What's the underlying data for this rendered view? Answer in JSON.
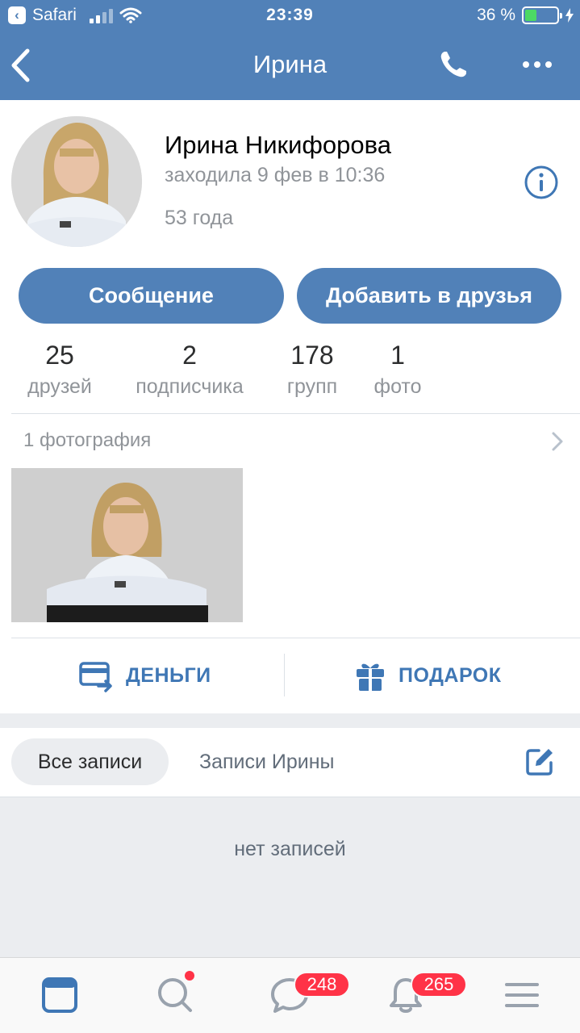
{
  "status_bar": {
    "back_app": "Safari",
    "time": "23:39",
    "battery": "36 %",
    "battery_level": 0.36
  },
  "nav": {
    "title": "Ирина",
    "icons": [
      "back-arrow-icon",
      "phone-icon",
      "more-icon"
    ]
  },
  "profile": {
    "name": "Ирина Никифорова",
    "last_seen": "заходила 9 фев в 10:36",
    "age": "53 года"
  },
  "buttons": {
    "message": "Сообщение",
    "add_friend": "Добавить в друзья"
  },
  "counters": [
    {
      "value": "25",
      "label": "друзей"
    },
    {
      "value": "2",
      "label": "подписчика"
    },
    {
      "value": "178",
      "label": "групп"
    },
    {
      "value": "1",
      "label": "фото"
    }
  ],
  "photos": {
    "header": "1 фотография"
  },
  "actions": {
    "money": "ДЕНЬГИ",
    "gift": "ПОДАРОК"
  },
  "posts": {
    "tab_all": "Все записи",
    "tab_own": "Записи Ирины",
    "empty": "нет записей"
  },
  "tabbar": {
    "icons": [
      "news-icon",
      "search-icon",
      "messages-icon",
      "notifications-icon",
      "menu-icon"
    ],
    "messages_badge": "248",
    "notifications_badge": "265"
  },
  "colors": {
    "header": "#5181b8",
    "accent": "#3f77b5",
    "badge": "#ff3347",
    "battery": "#4cd964"
  }
}
